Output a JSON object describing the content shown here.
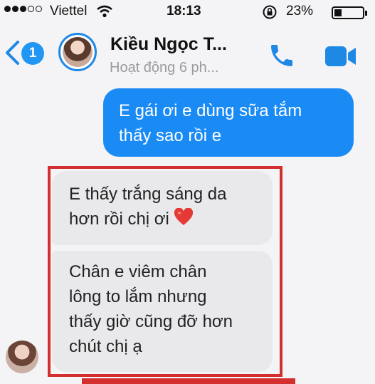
{
  "status_bar": {
    "carrier": "Viettel",
    "time": "18:13",
    "battery": "23%"
  },
  "header": {
    "back_badge": "1",
    "contact_name": "Kiều Ngọc T...",
    "contact_status": "Hoạt động 6 ph...",
    "icons": [
      "back-chevron-icon",
      "phone-icon",
      "video-camera-icon"
    ]
  },
  "messages": {
    "outgoing": {
      "lines": [
        "E gái ơi e dùng sữa tắm",
        "thấy sao rồi e"
      ]
    },
    "incoming_1": {
      "lines": [
        "E thấy trắng sáng da",
        "hơn rồi chị ơi"
      ]
    },
    "incoming_2": {
      "lines": [
        "Chân e viêm chân",
        "lông to lắm nhưng",
        "thấy giờ cũng đỡ hơn",
        "chút chị ạ"
      ]
    }
  },
  "colors": {
    "outgoing_bubble": "#1a8bf5",
    "incoming_bubble": "#e9e9ec",
    "highlight": "#d32f2f",
    "accent": "#1e88e5"
  }
}
